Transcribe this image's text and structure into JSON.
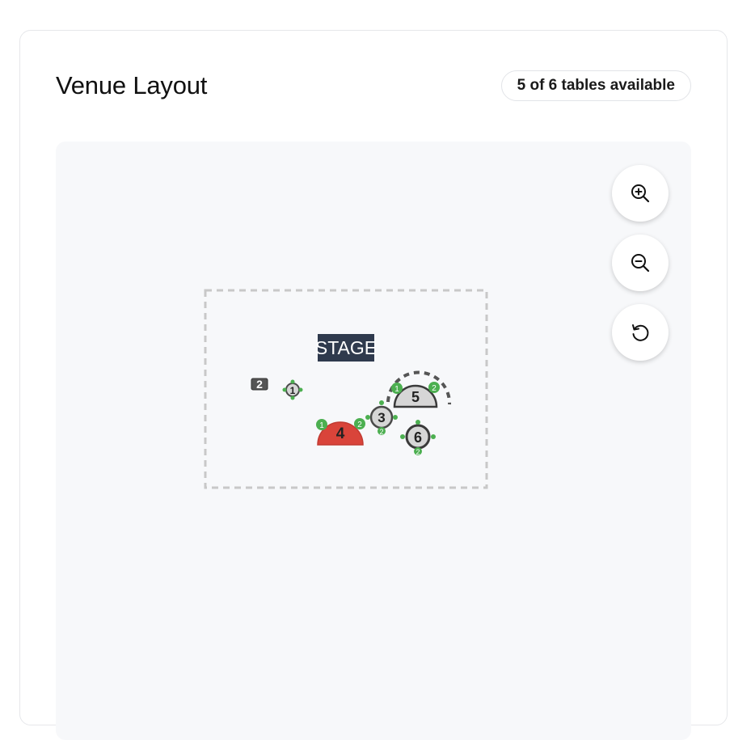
{
  "header": {
    "title": "Venue Layout",
    "availability": "5 of 6 tables available"
  },
  "controls": {
    "zoom_in_icon": "zoom-in-icon",
    "zoom_out_icon": "zoom-out-icon",
    "reset_icon": "reset-icon"
  },
  "floor_plan": {
    "stage_label": "STAGE",
    "tables": [
      {
        "number": "1",
        "status": "available",
        "seat_labels": [
          "1",
          "2"
        ]
      },
      {
        "number": "2",
        "status": "available",
        "seat_labels": []
      },
      {
        "number": "3",
        "status": "available",
        "seat_labels": [
          "1",
          "2"
        ]
      },
      {
        "number": "4",
        "status": "reserved",
        "seat_labels": [
          "1",
          "2"
        ]
      },
      {
        "number": "5",
        "status": "available",
        "seat_labels": [
          "1",
          "2"
        ]
      },
      {
        "number": "6",
        "status": "available",
        "seat_labels": [
          "1",
          "2"
        ]
      }
    ]
  },
  "colors": {
    "accent_seat": "#4caf50",
    "reserved_table": "#d9443a",
    "table_fill": "#d6d6d6",
    "table_stroke": "#4a4a4a",
    "stage_fill": "#2f3a4d",
    "canvas_bg": "#f7f8fa"
  }
}
